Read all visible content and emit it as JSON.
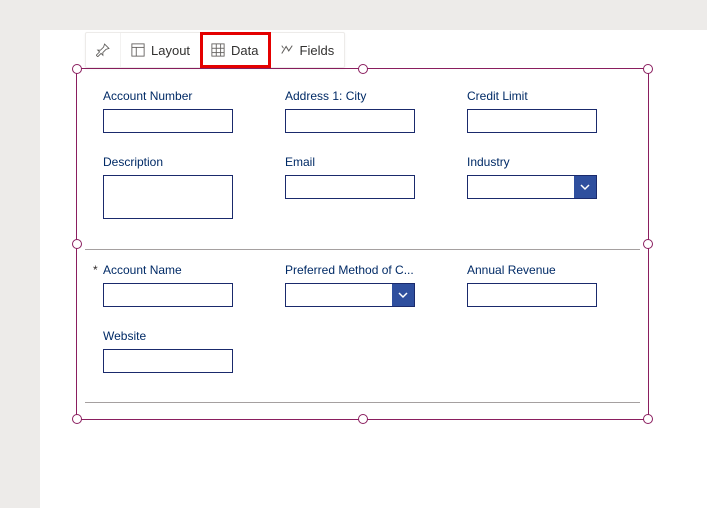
{
  "toolbar": {
    "layout_label": "Layout",
    "data_label": "Data",
    "fields_label": "Fields"
  },
  "fields": {
    "section1": {
      "account_number": {
        "label": "Account Number"
      },
      "address1_city": {
        "label": "Address 1: City"
      },
      "credit_limit": {
        "label": "Credit Limit"
      },
      "description": {
        "label": "Description"
      },
      "email": {
        "label": "Email"
      },
      "industry": {
        "label": "Industry"
      }
    },
    "section2": {
      "account_name": {
        "label": "Account Name",
        "required": "*"
      },
      "preferred_method": {
        "label": "Preferred Method of C..."
      },
      "annual_revenue": {
        "label": "Annual Revenue"
      },
      "website": {
        "label": "Website"
      }
    }
  }
}
